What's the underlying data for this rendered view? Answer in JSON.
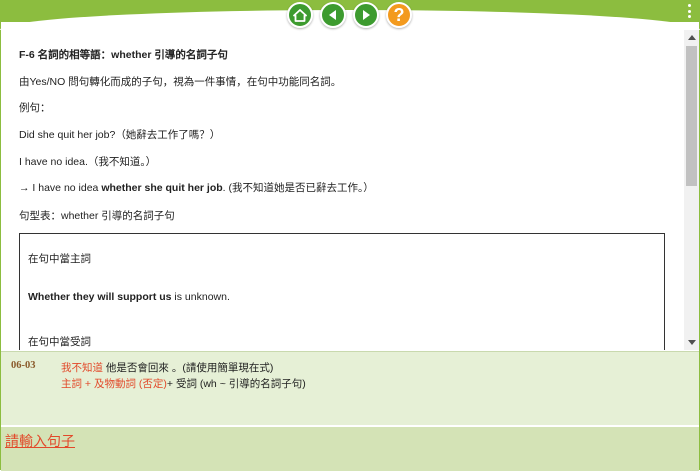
{
  "nav": {
    "help_label": "?",
    "accent": "#8cbd3f",
    "button_green": "#3d9b2f",
    "button_orange": "#f39a1e"
  },
  "lesson": {
    "title": "F-6  名詞的相等語：whether 引導的名詞子句",
    "intro": "由Yes/NO 問句轉化而成的子句，視為一件事情，在句中功能同名詞。",
    "example_label": "例句：",
    "ex1_en": "Did she quit her job?",
    "ex1_zh": "（她辭去工作了嗎？）",
    "ex2_en": "I have no idea.",
    "ex2_zh": "（我不知道。）",
    "ex3_prefix": "→ I have no idea ",
    "ex3_bold": "whether she quit her job",
    "ex3_zh": ". (我不知道她是否已辭去工作。）",
    "pattern_title": "句型表：whether 引導的名詞子句",
    "box": {
      "subject_heading": "在句中當主詞",
      "subject_bold": "Whether they will support us",
      "subject_rest": " is unknown.",
      "object_heading": "在句中當受詞"
    }
  },
  "exercise": {
    "number": "06-03",
    "prompt_red": "我不知道",
    "prompt_rest": " 他是否會回來 。(請使用簡單現在式)",
    "hint_red": "主詞 + 及物動詞 (否定)",
    "hint_rest": "+ 受詞 (wh ~ 引導的名詞子句)"
  },
  "answer": {
    "link_label": "請輸入句子"
  }
}
